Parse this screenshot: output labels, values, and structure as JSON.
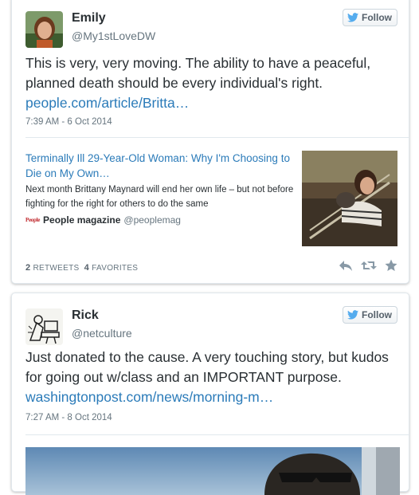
{
  "tweets": [
    {
      "author_name": "Emily",
      "author_handle": "@My1stLoveDW",
      "follow_label": "Follow",
      "text": "This is very, very moving.  The ability to have a peaceful, planned death should be every individual's right. ",
      "link": "people.com/article/Britta…",
      "time": "7:39 AM - 6 Oct 2014",
      "card": {
        "title": "Terminally Ill 29-Year-Old Woman: Why I'm Choosing to Die on My Own…",
        "description": "Next month Brittany Maynard will end her own life – but not before fighting for the right for others to do the same",
        "source_logo": "People",
        "source_name": "People magazine",
        "source_handle": "@peoplemag"
      },
      "retweets_count": "2",
      "retweets_label": "RETWEETS",
      "favorites_count": "4",
      "favorites_label": "FAVORITES"
    },
    {
      "author_name": "Rick",
      "author_handle": "@netculture",
      "follow_label": "Follow",
      "text": "Just donated to the cause.  A very touching story, but kudos for going out w/class and an IMPORTANT purpose.  ",
      "link": "washingtonpost.com/news/morning-m…",
      "time": "7:27 AM - 8 Oct 2014"
    }
  ],
  "icons": {
    "follow": "twitter-bird-icon",
    "reply": "reply-icon",
    "retweet": "retweet-icon",
    "favorite": "star-icon"
  },
  "colors": {
    "link": "#2b7bb9",
    "text": "#292f33",
    "muted": "#66757f",
    "border": "#e1e8ed",
    "bird": "#55acee"
  }
}
